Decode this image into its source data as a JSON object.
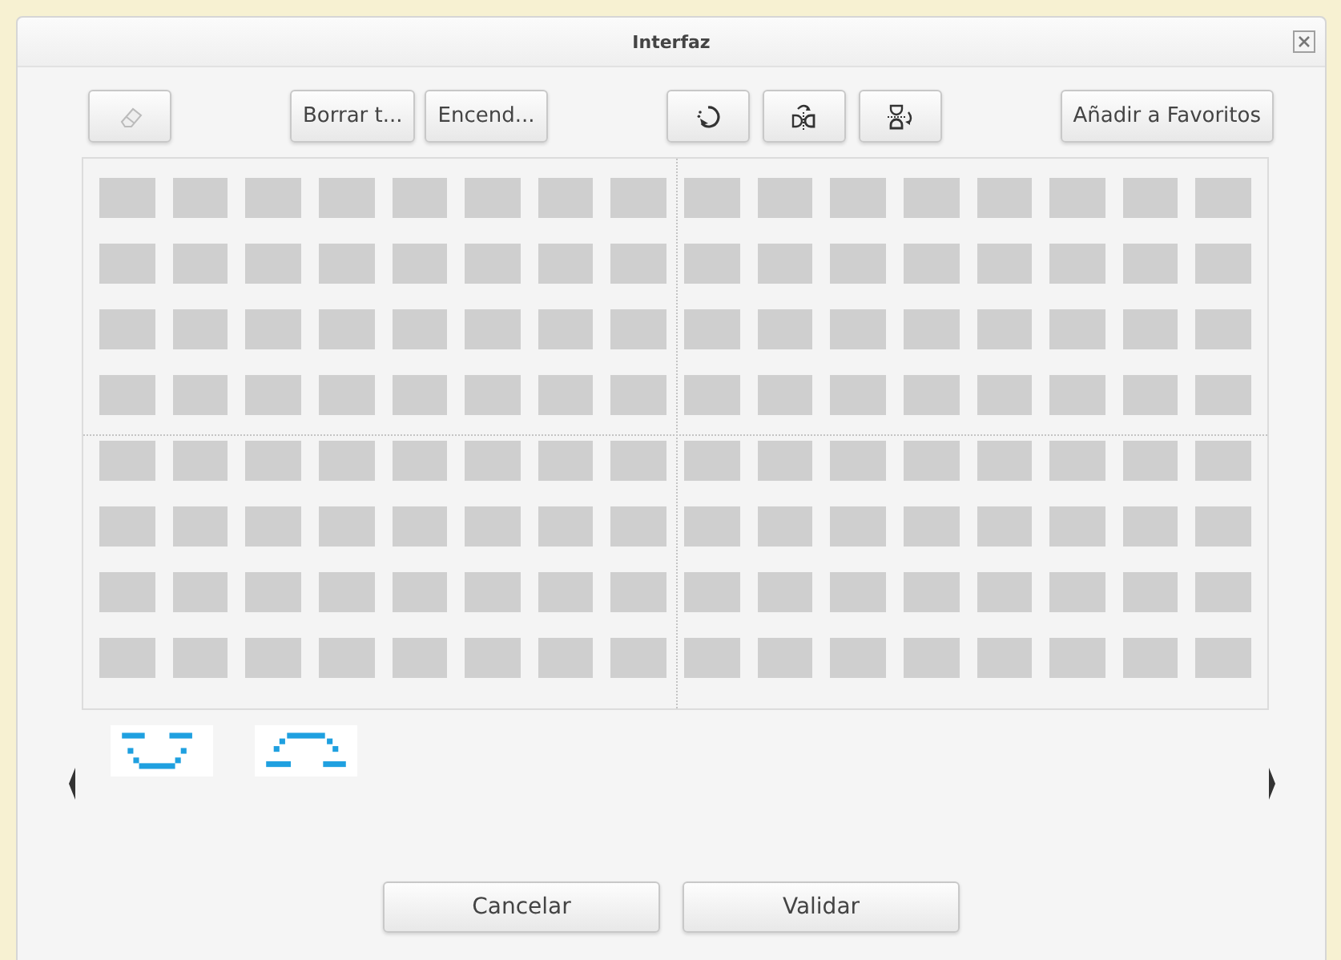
{
  "window": {
    "title": "Interfaz"
  },
  "toolbar": {
    "groups": [
      [
        {
          "kind": "eraser"
        }
      ],
      [
        {
          "kind": "text",
          "label": "Borrar t..."
        },
        {
          "kind": "text",
          "label": "Encend..."
        }
      ],
      [
        {
          "kind": "rotate"
        },
        {
          "kind": "mirror"
        },
        {
          "kind": "flip"
        }
      ],
      [
        {
          "kind": "text",
          "label": "Añadir a Favoritos"
        }
      ]
    ]
  },
  "matrix": {
    "rows": [
      [
        false,
        false,
        false,
        false,
        false,
        false,
        false,
        false,
        false,
        false,
        false,
        false,
        false,
        false,
        false,
        false
      ],
      [
        false,
        false,
        false,
        false,
        false,
        false,
        false,
        false,
        false,
        false,
        false,
        false,
        false,
        false,
        false,
        false
      ],
      [
        false,
        false,
        false,
        false,
        false,
        false,
        false,
        false,
        false,
        false,
        false,
        false,
        false,
        false,
        false,
        false
      ],
      [
        false,
        false,
        false,
        false,
        false,
        false,
        false,
        false,
        false,
        false,
        false,
        false,
        false,
        false,
        false,
        false
      ],
      [
        false,
        false,
        false,
        false,
        false,
        false,
        false,
        false,
        false,
        false,
        false,
        false,
        false,
        false,
        false,
        false
      ],
      [
        false,
        false,
        false,
        false,
        false,
        false,
        false,
        false,
        false,
        false,
        false,
        false,
        false,
        false,
        false,
        false
      ],
      [
        false,
        false,
        false,
        false,
        false,
        false,
        false,
        false,
        false,
        false,
        false,
        false,
        false,
        false,
        false,
        false
      ],
      [
        false,
        false,
        false,
        false,
        false,
        false,
        false,
        false,
        false,
        false,
        false,
        false,
        false,
        false,
        false,
        false
      ]
    ]
  },
  "presets": [
    {
      "kind": "smile"
    },
    {
      "kind": "frown"
    }
  ],
  "buttons": [
    "Cancelar",
    "Validar"
  ]
}
